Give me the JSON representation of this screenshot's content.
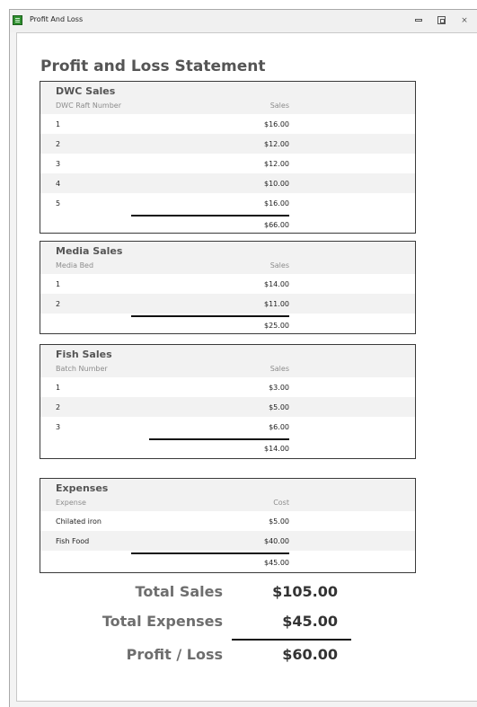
{
  "window": {
    "title": "Profit And Loss",
    "icon": "access-report-icon"
  },
  "report": {
    "title": "Profit and Loss Statement",
    "sections": [
      {
        "title": "DWC Sales",
        "label_header": "DWC Raft Number",
        "value_header": "Sales",
        "rows": [
          {
            "key": "1",
            "value": "$16.00"
          },
          {
            "key": "2",
            "value": "$12.00"
          },
          {
            "key": "3",
            "value": "$12.00"
          },
          {
            "key": "4",
            "value": "$10.00"
          },
          {
            "key": "5",
            "value": "$16.00"
          }
        ],
        "total": "$66.00"
      },
      {
        "title": "Media Sales",
        "label_header": "Media Bed",
        "value_header": "Sales",
        "rows": [
          {
            "key": "1",
            "value": "$14.00"
          },
          {
            "key": "2",
            "value": "$11.00"
          }
        ],
        "total": "$25.00"
      },
      {
        "title": "Fish Sales",
        "label_header": "Batch Number",
        "value_header": "Sales",
        "rows": [
          {
            "key": "1",
            "value": "$3.00"
          },
          {
            "key": "2",
            "value": "$5.00"
          },
          {
            "key": "3",
            "value": "$6.00"
          }
        ],
        "total": "$14.00"
      },
      {
        "title": "Expenses",
        "label_header": "Expense",
        "value_header": "Cost",
        "rows": [
          {
            "key": "Chilated iron",
            "value": "$5.00"
          },
          {
            "key": "Fish Food",
            "value": "$40.00"
          }
        ],
        "total": "$45.00"
      }
    ],
    "summary": {
      "total_sales_label": "Total Sales",
      "total_sales_value": "$105.00",
      "total_expenses_label": "Total Expenses",
      "total_expenses_value": "$45.00",
      "profit_loss_label": "Profit / Loss",
      "profit_loss_value": "$60.00"
    }
  },
  "colors": {
    "heading_gray": "#555555",
    "band_gray": "#f2f2f2",
    "border": "#3a3a3a"
  }
}
